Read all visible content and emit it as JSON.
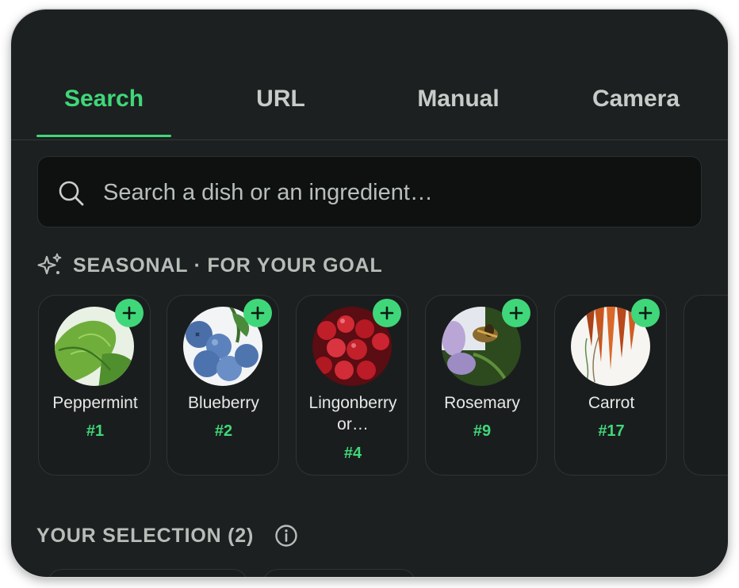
{
  "tabs": [
    {
      "label": "Search",
      "active": true
    },
    {
      "label": "URL",
      "active": false
    },
    {
      "label": "Manual",
      "active": false
    },
    {
      "label": "Camera",
      "active": false
    }
  ],
  "search": {
    "placeholder": "Search a dish or an ingredient…",
    "value": "",
    "icon": "search-icon"
  },
  "seasonal": {
    "icon": "sparkle-icon",
    "title": "SEASONAL · FOR YOUR GOAL",
    "items": [
      {
        "name": "Peppermint",
        "rank": "#1"
      },
      {
        "name": "Blueberry",
        "rank": "#2"
      },
      {
        "name": "Lingonberry or…",
        "name_line1": "Lingonberry",
        "name_line2": "or…",
        "rank": "#4"
      },
      {
        "name": "Rosemary",
        "rank": "#9"
      },
      {
        "name": "Carrot",
        "rank": "#17"
      }
    ]
  },
  "selection": {
    "title": "YOUR SELECTION (2)",
    "icon": "info-icon"
  },
  "colors": {
    "accent": "#3fd77a",
    "background": "#1d2020",
    "card": "#1a1d1d",
    "text_muted": "#b7beb9"
  }
}
